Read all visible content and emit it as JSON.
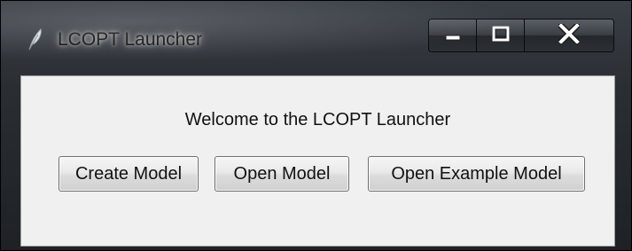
{
  "window": {
    "title": "LCOPT Launcher",
    "app_icon": "feather-icon"
  },
  "caption_buttons": {
    "minimize_icon": "minimize-icon",
    "maximize_icon": "maximize-icon",
    "close_icon": "close-icon"
  },
  "content": {
    "welcome_text": "Welcome to the LCOPT Launcher",
    "buttons": {
      "create": "Create Model",
      "open": "Open Model",
      "open_example": "Open Example Model"
    }
  },
  "colors": {
    "client_background": "#f0f0f0",
    "titlebar": "#2a2e33"
  }
}
